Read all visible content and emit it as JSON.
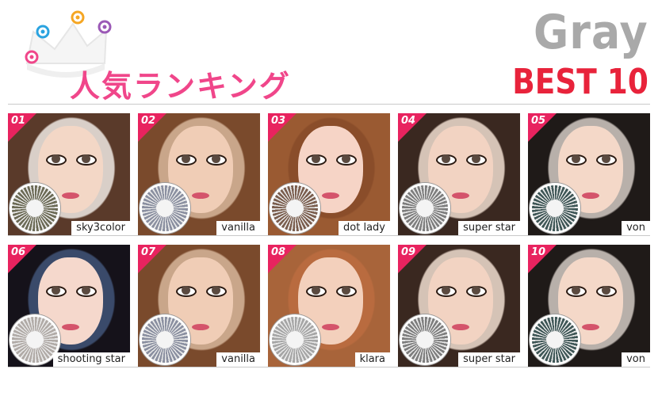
{
  "header": {
    "jp_title": "人気ランキング",
    "color_title": "Gray",
    "best_title": "BEST 10",
    "colors": {
      "pink": "#f0468a",
      "red": "#e8233b",
      "gray": "#a9a9a9",
      "rank_badge": "#e8235f"
    }
  },
  "ranking": {
    "rows": [
      {
        "items": [
          {
            "rank": "01",
            "name": "sky3color",
            "bg": "#d9cfc8",
            "hair": "#5a3a2a",
            "skin": "#f3d7c6",
            "lens": "#6b6a55"
          },
          {
            "rank": "02",
            "name": "vanilla",
            "bg": "#c9a68a",
            "hair": "#7a4a2c",
            "skin": "#f0cdb6",
            "lens": "#8a8fa0"
          },
          {
            "rank": "03",
            "name": "dot lady",
            "bg": "#8a4d2a",
            "hair": "#9a5a32",
            "skin": "#f6d4c6",
            "lens": "#7a5d4d"
          },
          {
            "rank": "04",
            "name": "super star",
            "bg": "#d5c3b6",
            "hair": "#3a2820",
            "skin": "#f2d3c2",
            "lens": "#7d7d7d"
          },
          {
            "rank": "05",
            "name": "von",
            "bg": "#b8b0aa",
            "hair": "#1f1a18",
            "skin": "#f4d8c8",
            "lens": "#3e5656"
          }
        ]
      },
      {
        "items": [
          {
            "rank": "06",
            "name": "shooting star",
            "bg": "#3a4a6a",
            "hair": "#15121a",
            "skin": "#f5d8cc",
            "lens": "#b0aaa6"
          },
          {
            "rank": "07",
            "name": "vanilla",
            "bg": "#c9a68a",
            "hair": "#7a4a2c",
            "skin": "#f0cdb6",
            "lens": "#8a8fa0"
          },
          {
            "rank": "08",
            "name": "klara",
            "bg": "#b96b3f",
            "hair": "#a8643a",
            "skin": "#f3d0bc",
            "lens": "#a5a5a5"
          },
          {
            "rank": "09",
            "name": "super star",
            "bg": "#d5c3b6",
            "hair": "#3a2820",
            "skin": "#f2d3c2",
            "lens": "#7d7d7d"
          },
          {
            "rank": "10",
            "name": "von",
            "bg": "#b8b0aa",
            "hair": "#1f1a18",
            "skin": "#f4d8c8",
            "lens": "#3e5656"
          }
        ]
      }
    ]
  }
}
